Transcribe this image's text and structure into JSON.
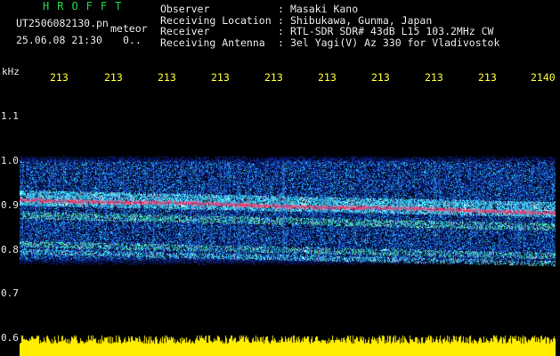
{
  "header": {
    "title_letters": "HROFFT",
    "filename": "UT2506082130.pn",
    "meteor_label": "meteor",
    "datetime": "25.06.08 21:30",
    "meteor_count": "0..",
    "info": [
      {
        "label": "Observer",
        "value": "Masaki Kano"
      },
      {
        "label": "Receiving Location",
        "value": "Shibukawa, Gunma, Japan"
      },
      {
        "label": "Receiver",
        "value": "RTL-SDR SDR# 43dB L15 103.2MHz CW"
      },
      {
        "label": "Receiving Antenna",
        "value": "3el Yagi(V) Az 330 for Vladivostok"
      }
    ]
  },
  "axis": {
    "y_unit": "kHz",
    "y_ticks": [
      "1.1",
      "1.0",
      "0.9",
      "0.8",
      "0.7",
      "0.6"
    ],
    "x_ticks": [
      "213",
      "213",
      "213",
      "213",
      "213",
      "213",
      "213",
      "213",
      "213",
      "2140"
    ]
  },
  "colors": {
    "title_green": "#22d94a",
    "tick_yellow": "#ffff33",
    "text_white": "#e8e8e8",
    "background": "#000000",
    "trace_red": "#ff3366",
    "power_yellow": "#ffee00"
  }
}
